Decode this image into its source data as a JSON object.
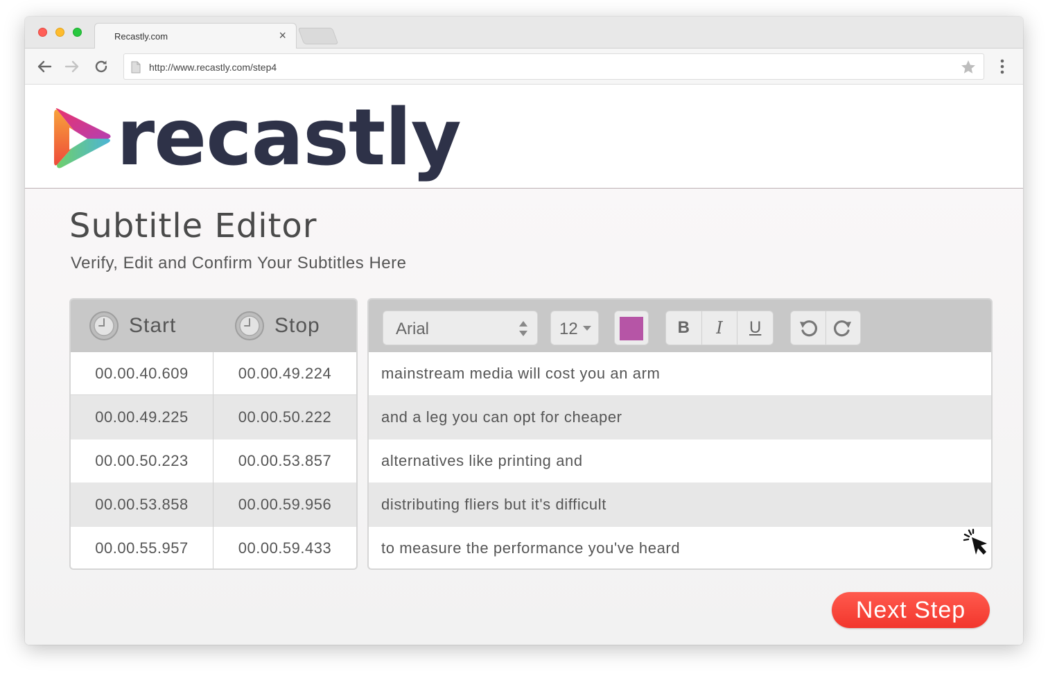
{
  "browser": {
    "tab_title": "Recastly.com",
    "tab_close": "×",
    "url": "http://www.recastly.com/step4"
  },
  "brand": {
    "name": "recastly",
    "colors": {
      "text": "#2e3248",
      "accent_red": "#f2362c",
      "swatch": "#b655a6"
    }
  },
  "page": {
    "title": "Subtitle Editor",
    "subtitle": "Verify, Edit and Confirm Your Subtitles Here"
  },
  "times": {
    "start_label": "Start",
    "stop_label": "Stop",
    "rows": [
      {
        "start": "00.00.40.609",
        "stop": "00.00.49.224"
      },
      {
        "start": "00.00.49.225",
        "stop": "00.00.50.222"
      },
      {
        "start": "00.00.50.223",
        "stop": "00.00.53.857"
      },
      {
        "start": "00.00.53.858",
        "stop": "00.00.59.956"
      },
      {
        "start": "00.00.55.957",
        "stop": "00.00.59.433"
      }
    ]
  },
  "editor": {
    "font": "Arial",
    "size": "12",
    "bold_label": "B",
    "italic_label": "I",
    "underline_label": "U",
    "lines": [
      "mainstream media will cost you an arm",
      "and a leg you can opt for cheaper",
      "alternatives like printing and",
      "distributing fliers but it's difficult",
      "to measure the performance you've heard"
    ]
  },
  "actions": {
    "next_label": "Next Step"
  },
  "icons": [
    "back-arrow-icon",
    "forward-arrow-icon",
    "reload-icon",
    "page-icon",
    "star-icon",
    "menu-dots-icon",
    "clock-icon",
    "undo-icon",
    "redo-icon",
    "pointer-cursor-icon"
  ]
}
